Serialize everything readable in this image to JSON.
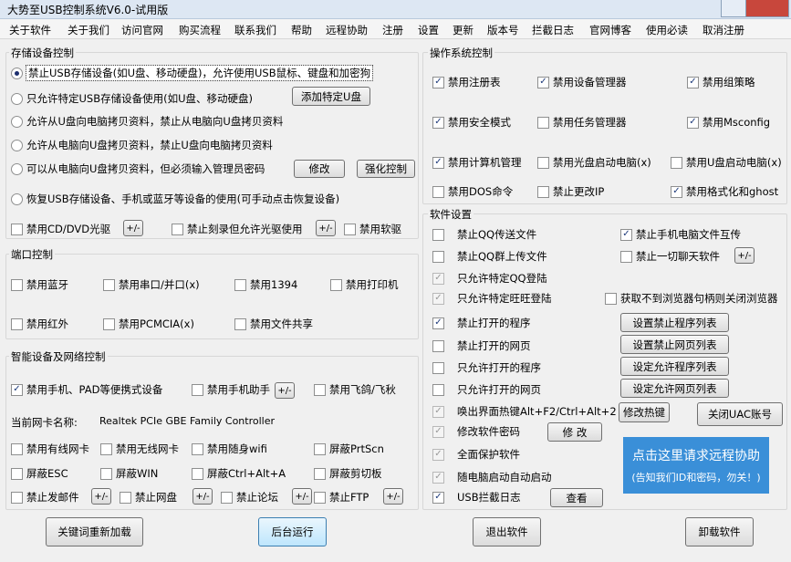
{
  "window": {
    "title": "大势至USB控制系统V6.0-试用版"
  },
  "menu": [
    "关于软件",
    "关于我们",
    "访问官网",
    "购买流程",
    "联系我们",
    "帮助",
    "远程协助",
    "注册",
    "设置",
    "更新",
    "版本号",
    "拦截日志",
    "官网博客",
    "使用必读",
    "取消注册"
  ],
  "storage": {
    "title": "存储设备控制",
    "radios": [
      "禁止USB存储设备(如U盘、移动硬盘)，允许使用USB鼠标、键盘和加密狗",
      "只允许特定USB存储设备使用(如U盘、移动硬盘)",
      "允许从U盘向电脑拷贝资料，禁止从电脑向U盘拷贝资料",
      "允许从电脑向U盘拷贝资料，禁止U盘向电脑拷贝资料",
      "可以从电脑向U盘拷贝资料，但必须输入管理员密码",
      "恢复USB存储设备、手机或蓝牙等设备的使用(可手动点击恢复设备)"
    ],
    "add_u_button": "添加特定U盘",
    "modify_button": "修改",
    "force_button": "强化控制",
    "cd": "禁用CD/DVD光驱",
    "burn": "禁止刻录但允许光驱使用",
    "floppy": "禁用软驱",
    "plus": "+/-"
  },
  "port": {
    "title": "端口控制",
    "bluetooth": "禁用蓝牙",
    "serial": "禁用串口/并口(x)",
    "p1394": "禁用1394",
    "printer": "禁用打印机",
    "infrared": "禁用红外",
    "pcmcia": "禁用PCMCIA(x)",
    "share": "禁用文件共享"
  },
  "smart": {
    "title": "智能设备及网络控制",
    "phone": "禁用手机、PAD等便携式设备",
    "assistant": "禁用手机助手",
    "feige": "禁用飞鸽/飞秋",
    "nic_label": "当前网卡名称:",
    "nic_name": "Realtek PCIe GBE Family Controller",
    "wired": "禁用有线网卡",
    "wireless": "禁用无线网卡",
    "wifi": "禁用随身wifi",
    "prtscn": "屏蔽PrtScn",
    "esc": "屏蔽ESC",
    "win": "屏蔽WIN",
    "ctrlalta": "屏蔽Ctrl+Alt+A",
    "clip": "屏蔽剪切板",
    "mail": "禁止发邮件",
    "netdisk": "禁止网盘",
    "forum": "禁止论坛",
    "ftp": "禁止FTP"
  },
  "os": {
    "title": "操作系统控制",
    "regedit": "禁用注册表",
    "devmgr": "禁用设备管理器",
    "gpedit": "禁用组策略",
    "safemode": "禁用安全模式",
    "taskmgr": "禁用任务管理器",
    "msconfig": "禁用Msconfig",
    "compmgmt": "禁用计算机管理",
    "cdboot": "禁用光盘启动电脑(x)",
    "uboot": "禁用U盘启动电脑(x)",
    "dos": "禁用DOS命令",
    "ip": "禁止更改IP",
    "format": "禁用格式化和ghost"
  },
  "software": {
    "title": "软件设置",
    "qqfile": "禁止QQ传送文件",
    "phonefile": "禁止手机电脑文件互传",
    "qqgroup": "禁止QQ群上传文件",
    "chat": "禁止一切聊天软件",
    "qqlogin": "只允许特定QQ登陆",
    "wwlogin": "只允许特定旺旺登陆",
    "browser": "获取不到浏览器句柄则关闭浏览器",
    "progblock": "禁止打开的程序",
    "progblock_btn": "设置禁止程序列表",
    "webblock": "禁止打开的网页",
    "webblock_btn": "设置禁止网页列表",
    "progallow": "只允许打开的程序",
    "progallow_btn": "设定允许程序列表",
    "weballow": "只允许打开的网页",
    "weballow_btn": "设定允许网页列表",
    "hotkey": "唤出界面热键Alt+F2/Ctrl+Alt+2",
    "hotkey_btn": "修改热键",
    "uac_btn": "关闭UAC账号",
    "pwd": "修改软件密码",
    "pwd_btn": "修 改",
    "protect": "全面保护软件",
    "autostart": "随电脑启动自动启动",
    "usblog": "USB拦截日志",
    "view_btn": "查看",
    "remote_line1": "点击这里请求远程协助",
    "remote_line2": "(告知我们ID和密码，勿关！)"
  },
  "footer": {
    "reload": "关键词重新加载",
    "background": "后台运行",
    "exit": "退出软件",
    "uninstall": "卸载软件"
  },
  "check_mark": "✓",
  "colors": {
    "accent": "#3a8fd8",
    "titlebar": "#dde7f3"
  }
}
